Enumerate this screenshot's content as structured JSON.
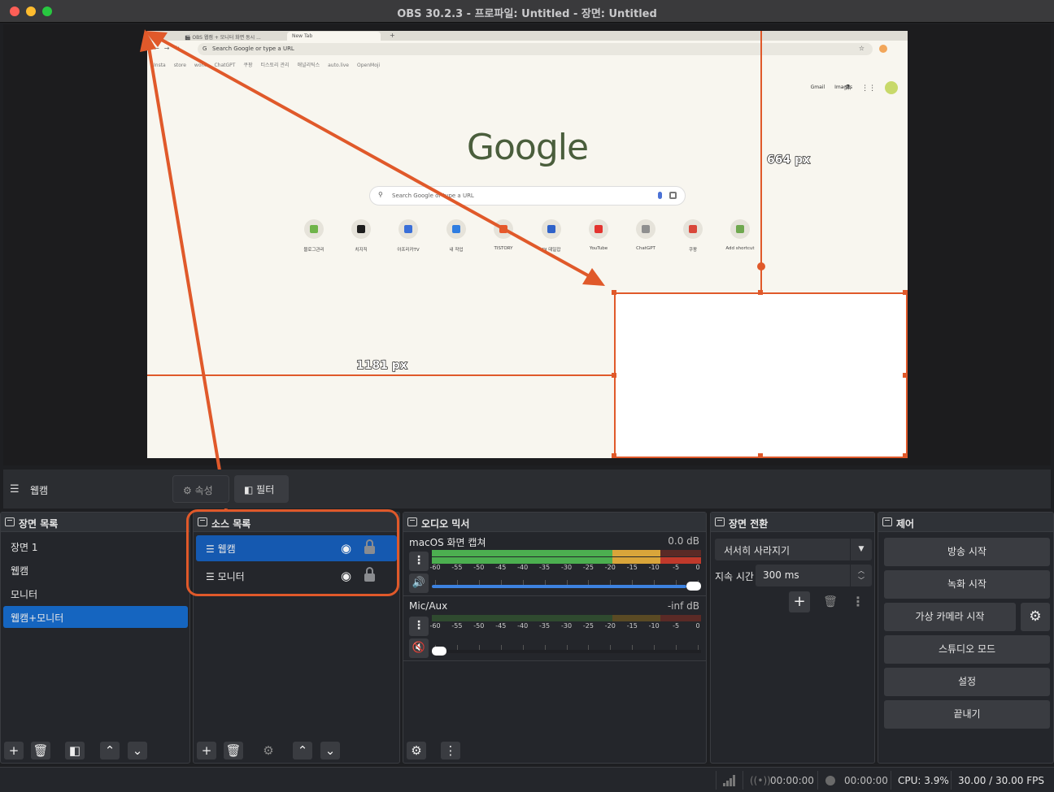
{
  "window": {
    "title": "OBS 30.2.3 - 프로파일: Untitled - 장면: Untitled"
  },
  "browser": {
    "tab_1": "🎬 OBS 웹캠 + 모니터 화면 동시 ...",
    "tab_2": "New Tab",
    "omnibox": "Search Google or type a URL",
    "bookmarks": [
      "Insta",
      "store",
      "work",
      "ChatGPT",
      "쿠팡",
      "티스토리 관리",
      "애널리틱스",
      "auto.live",
      "OpenMoji"
    ],
    "links": [
      "Gmail",
      "Images"
    ],
    "logo": "Google",
    "search_placeholder": "Search Google or type a URL",
    "shortcuts": [
      {
        "label": "블로그관리",
        "color": "#6fb44a"
      },
      {
        "label": "치지직",
        "color": "#1d1d1d"
      },
      {
        "label": "아프리카TV",
        "color": "#3a6fd8"
      },
      {
        "label": "내 작업",
        "color": "#2f7de1"
      },
      {
        "label": "TISTORY",
        "color": "#e8572b"
      },
      {
        "label": "DI 데일잡",
        "color": "#2f62c9"
      },
      {
        "label": "YouTube",
        "color": "#e3342f"
      },
      {
        "label": "ChatGPT",
        "color": "#8f8f8f"
      },
      {
        "label": "쿠팡",
        "color": "#d9473a"
      },
      {
        "label": "Add shortcut",
        "color": "#6fa84f"
      }
    ]
  },
  "preview": {
    "dim_height_label": "664 px",
    "dim_width_label": "1181 px",
    "accent": "#e0592a"
  },
  "source_bar": {
    "selected_source": "웹캠",
    "properties_label": "속성",
    "filters_label": "필터"
  },
  "scenes": {
    "title": "장면 목록",
    "items": [
      "장면 1",
      "웹캠",
      "모니터",
      "웹캠+모니터"
    ],
    "active_index": 3
  },
  "sources": {
    "title": "소스 목록",
    "items": [
      "웹캠",
      "모니터"
    ],
    "active_index": 0
  },
  "mixer": {
    "title": "오디오 믹서",
    "channels": [
      {
        "name": "macOS 화면 캡쳐",
        "db": "0.0 dB",
        "volume": 1.0,
        "muted": false
      },
      {
        "name": "Mic/Aux",
        "db": "-inf dB",
        "volume": 0.0,
        "muted": true
      }
    ],
    "scale": [
      "-60",
      "-55",
      "-50",
      "-45",
      "-40",
      "-35",
      "-30",
      "-25",
      "-20",
      "-15",
      "-10",
      "-5",
      "0"
    ]
  },
  "transitions": {
    "title": "장면 전환",
    "selected": "서서히 사라지기",
    "duration_label": "지속 시간",
    "duration_value": "300 ms"
  },
  "controls": {
    "title": "제어",
    "start_streaming": "방송 시작",
    "start_recording": "녹화 시작",
    "start_virtual_cam": "가상 카메라 시작",
    "studio_mode": "스튜디오 모드",
    "settings": "설정",
    "exit": "끝내기"
  },
  "status": {
    "stream_time": "00:00:00",
    "record_time": "00:00:00",
    "cpu": "CPU: 3.9%",
    "fps": "30.00 / 30.00 FPS"
  }
}
